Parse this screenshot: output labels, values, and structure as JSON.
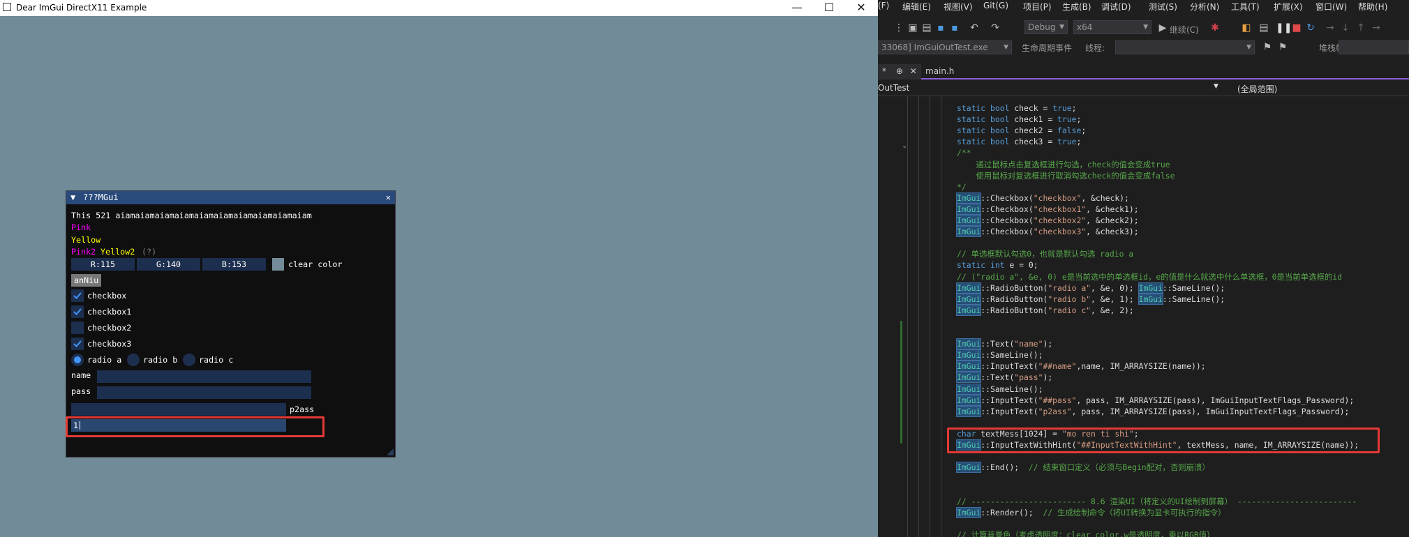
{
  "app": {
    "title": "Dear ImGui DirectX11 Example",
    "min": "—",
    "max": "☐",
    "close": "✕"
  },
  "imgui": {
    "title": "???MGui",
    "collapse": "▼",
    "close": "✕",
    "line1": "This 521 aiamaiamaiamaiamaiamaiamaiamaiamaiamaiam",
    "pink": "Pink",
    "yellow": "Yellow",
    "pink2": "Pink2",
    "yellow2": "Yellow2",
    "help": "(?)",
    "r": "R:115",
    "g": "G:140",
    "b": "B:153",
    "clear_color_label": "clear color",
    "button": "anNiu",
    "checkboxes": [
      {
        "label": "checkbox",
        "checked": true
      },
      {
        "label": "checkbox1",
        "checked": true
      },
      {
        "label": "checkbox2",
        "checked": false
      },
      {
        "label": "checkbox3",
        "checked": true
      }
    ],
    "radios": [
      {
        "label": "radio a",
        "selected": true
      },
      {
        "label": "radio b",
        "selected": false
      },
      {
        "label": "radio c",
        "selected": false
      }
    ],
    "name_label": "name",
    "pass_label": "pass",
    "p2ass_label": "p2ass",
    "hint_value": "1",
    "colors": {
      "pink": "#ff00ff",
      "yellow": "#ffff00",
      "help": "#808080",
      "clear": "#738c99"
    }
  },
  "vs": {
    "menu": [
      "(F)",
      "编辑(E)",
      "视图(V)",
      "Git(G)",
      "项目(P)",
      "生成(B)",
      "调试(D)",
      "测试(S)",
      "分析(N)",
      "工具(T)",
      "扩展(X)",
      "窗口(W)",
      "帮助(H)"
    ],
    "config": "Debug",
    "platform": "x64",
    "continue": "继续(C)",
    "process": "33068] ImGuiOutTest.exe",
    "lifecycle": "生命周期事件",
    "thread_label": "线程:",
    "stackframe_label": "堆栈帧:",
    "tab_active_fragment": "*",
    "tab_pin": "⊕",
    "tab_close": "✕",
    "tab_main": "main.h",
    "nav_left": "OutTest",
    "nav_right": "(全局范围)",
    "code": [
      {
        "t": "static bool check = true;"
      },
      {
        "t": "static bool check1 = true;"
      },
      {
        "t": "static bool check2 = false;"
      },
      {
        "t": "static bool check3 = true;"
      },
      {
        "t": "/**"
      },
      {
        "t": "    通过鼠标点击复选框进行勾选，check的值会变成true"
      },
      {
        "t": "    使用鼠标对复选框进行取消勾选check的值会变成false"
      },
      {
        "t": "*/"
      },
      {
        "t": "ImGui::Checkbox(\"checkbox\", &check);"
      },
      {
        "t": "ImGui::Checkbox(\"checkbox1\", &check1);"
      },
      {
        "t": "ImGui::Checkbox(\"checkbox2\", &check2);"
      },
      {
        "t": "ImGui::Checkbox(\"checkbox3\", &check3);"
      },
      {
        "t": ""
      },
      {
        "t": "// 单选框默认勾选0，也就是默认勾选 radio a"
      },
      {
        "t": "static int e = 0;"
      },
      {
        "t": "// (\"radio a\", &e, 0) e是当前选中的单选框id，e的值是什么就选中什么单选框，0是当前单选框的id"
      },
      {
        "t": "ImGui::RadioButton(\"radio a\", &e, 0); ImGui::SameLine();"
      },
      {
        "t": "ImGui::RadioButton(\"radio b\", &e, 1); ImGui::SameLine();"
      },
      {
        "t": "ImGui::RadioButton(\"radio c\", &e, 2);"
      },
      {
        "t": ""
      },
      {
        "t": ""
      },
      {
        "t": "ImGui::Text(\"name\");"
      },
      {
        "t": "ImGui::SameLine();"
      },
      {
        "t": "ImGui::InputText(\"##name\",name, IM_ARRAYSIZE(name));"
      },
      {
        "t": "ImGui::Text(\"pass\");"
      },
      {
        "t": "ImGui::SameLine();"
      },
      {
        "t": "ImGui::InputText(\"##pass\", pass, IM_ARRAYSIZE(pass), ImGuiInputTextFlags_Password);"
      },
      {
        "t": "ImGui::InputText(\"p2ass\", pass, IM_ARRAYSIZE(pass), ImGuiInputTextFlags_Password);"
      },
      {
        "t": ""
      },
      {
        "t": "char textMess[1024] = \"mo ren ti shi\";"
      },
      {
        "t": "ImGui::InputTextWithHint(\"##InputTextWithHint\", textMess, name, IM_ARRAYSIZE(name));"
      },
      {
        "t": ""
      },
      {
        "t": "ImGui::End();  // 结束窗口定义（必须与Begin配对，否则崩溃）"
      },
      {
        "t": ""
      },
      {
        "t": ""
      },
      {
        "t": "// ------------------------ 8.6 渲染UI（将定义的UI绘制到屏幕） -------------------------"
      },
      {
        "t": "ImGui::Render();  // 生成绘制命令（将UI转换为显卡可执行的指令）"
      },
      {
        "t": ""
      },
      {
        "t": "// 计算背景色（考虑透明度：clear_color.w是透明度，乘以RGB值）"
      }
    ]
  }
}
